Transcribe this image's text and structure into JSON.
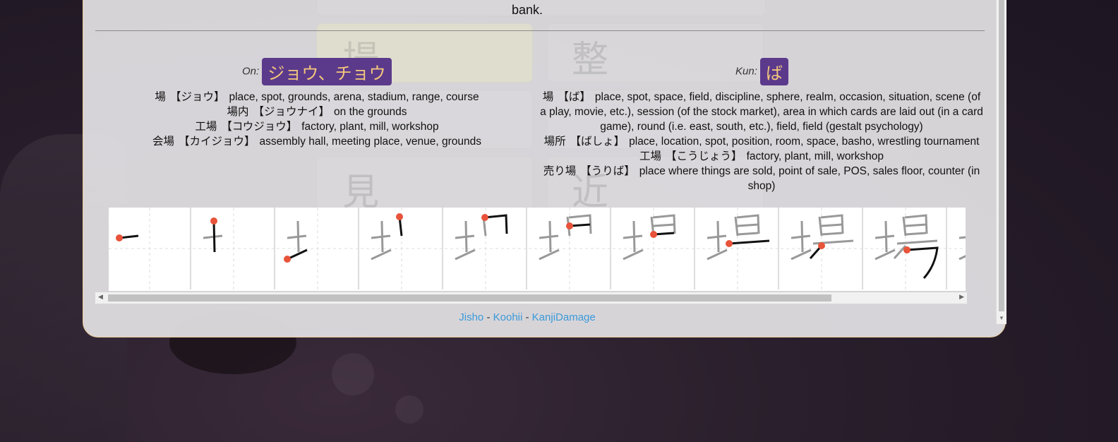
{
  "top_text": "bank.",
  "on_reading": {
    "label": "On:",
    "value": "ジョウ、チョウ"
  },
  "kun_reading": {
    "label": "Kun:",
    "value": "ば"
  },
  "on_vocab": [
    {
      "word": "場",
      "reading": "【ジョウ】",
      "meaning": "place, spot, grounds, arena, stadium, range, course"
    },
    {
      "word": "場内",
      "reading": "【ジョウナイ】",
      "meaning": "on the grounds"
    },
    {
      "word": "工場",
      "reading": "【コウジョウ】",
      "meaning": "factory, plant, mill, workshop"
    },
    {
      "word": "会場",
      "reading": "【カイジョウ】",
      "meaning": "assembly hall, meeting place, venue, grounds"
    }
  ],
  "kun_vocab": [
    {
      "word": "場",
      "reading": "【ば】",
      "meaning": "place, spot, space, field, discipline, sphere, realm, occasion, situation, scene (of a play, movie, etc.), session (of the stock market), area in which cards are laid out (in a card game), round (i.e. east, south, etc.), field, field (gestalt psychology)"
    },
    {
      "word": "場所",
      "reading": "【ばしょ】",
      "meaning": "place, location, spot, position, room, space, basho, wrestling tournament"
    },
    {
      "word": "工場",
      "reading": "【こうじょう】",
      "meaning": "factory, plant, mill, workshop"
    },
    {
      "word": "売り場",
      "reading": "【うりば】",
      "meaning": "place where things are sold, point of sale, POS, sales floor, counter (in shop)"
    }
  ],
  "background_glyphs": [
    "場",
    "整",
    "見",
    "近"
  ],
  "links": {
    "jisho": "Jisho",
    "sep1": " - ",
    "koohii": "Koohii",
    "sep2": " - ",
    "kanjidamage": "KanjiDamage"
  },
  "colors": {
    "badge_bg": "#5b3a8c",
    "badge_text": "#f4c77b",
    "link": "#3b9ad9",
    "stroke_dot": "#e8533a"
  }
}
